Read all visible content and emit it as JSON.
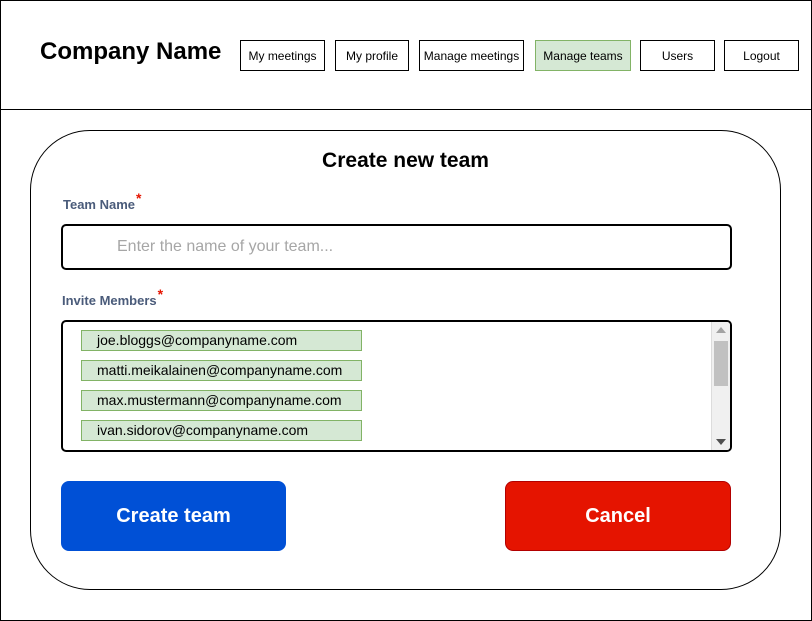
{
  "header": {
    "company_name": "Company Name",
    "nav": [
      {
        "label": "My meetings"
      },
      {
        "label": "My profile"
      },
      {
        "label": "Manage meetings"
      },
      {
        "label": "Manage teams",
        "active": true
      },
      {
        "label": "Users"
      },
      {
        "label": "Logout"
      }
    ]
  },
  "form": {
    "title": "Create new team",
    "team_name": {
      "label": "Team Name",
      "required_mark": "*",
      "value": "",
      "placeholder": "Enter the name of your team..."
    },
    "invite_members": {
      "label": "Invite Members",
      "required_mark": "*",
      "members": [
        "joe.bloggs@companyname.com",
        "matti.meikalainen@companyname.com",
        "max.mustermann@companyname.com",
        "ivan.sidorov@companyname.com"
      ]
    },
    "create_label": "Create team",
    "cancel_label": "Cancel"
  },
  "colors": {
    "active_nav": "#d5e8d4",
    "chip": "#d5e8d4",
    "create_button": "#0050d6",
    "cancel_button": "#e51400",
    "required": "#e51400"
  }
}
